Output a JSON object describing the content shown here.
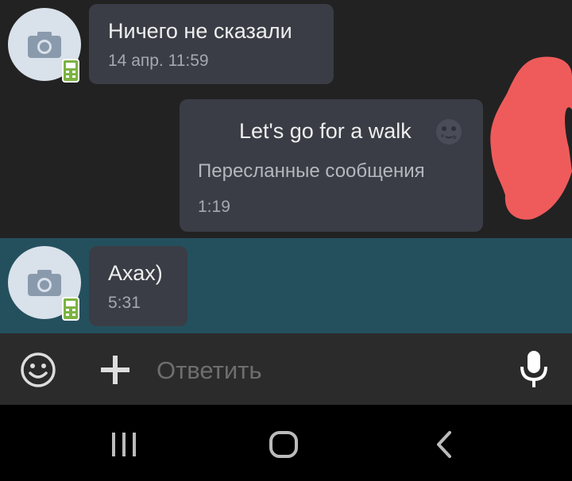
{
  "messages": [
    {
      "text": "Ничего не сказали",
      "time": "14 апр. 11:59",
      "direction": "incoming",
      "avatar_icon": "camera-icon",
      "badge_icon": "mobile-phone-icon"
    },
    {
      "text": "Let's go for a walk",
      "emoji": "🌚",
      "forwarded_label": "Пересланные сообщения",
      "time": "1:19",
      "direction": "outgoing"
    },
    {
      "text": "Ахах)",
      "time": "5:31",
      "direction": "incoming",
      "highlighted": true,
      "avatar_icon": "camera-icon",
      "badge_icon": "mobile-phone-icon"
    }
  ],
  "composer": {
    "placeholder": "Ответить",
    "left_icons": [
      "emoji-icon",
      "plus-icon"
    ],
    "right_icon": "microphone-icon"
  },
  "system_nav": [
    "recent-apps-icon",
    "home-icon",
    "back-icon"
  ],
  "colors": {
    "background": "#222222",
    "bubble": "#3a3d45",
    "highlight": "#24505e",
    "composer": "#2b2b2b",
    "badge_green": "#7cb342",
    "scribble_red": "#ef5b5b"
  }
}
